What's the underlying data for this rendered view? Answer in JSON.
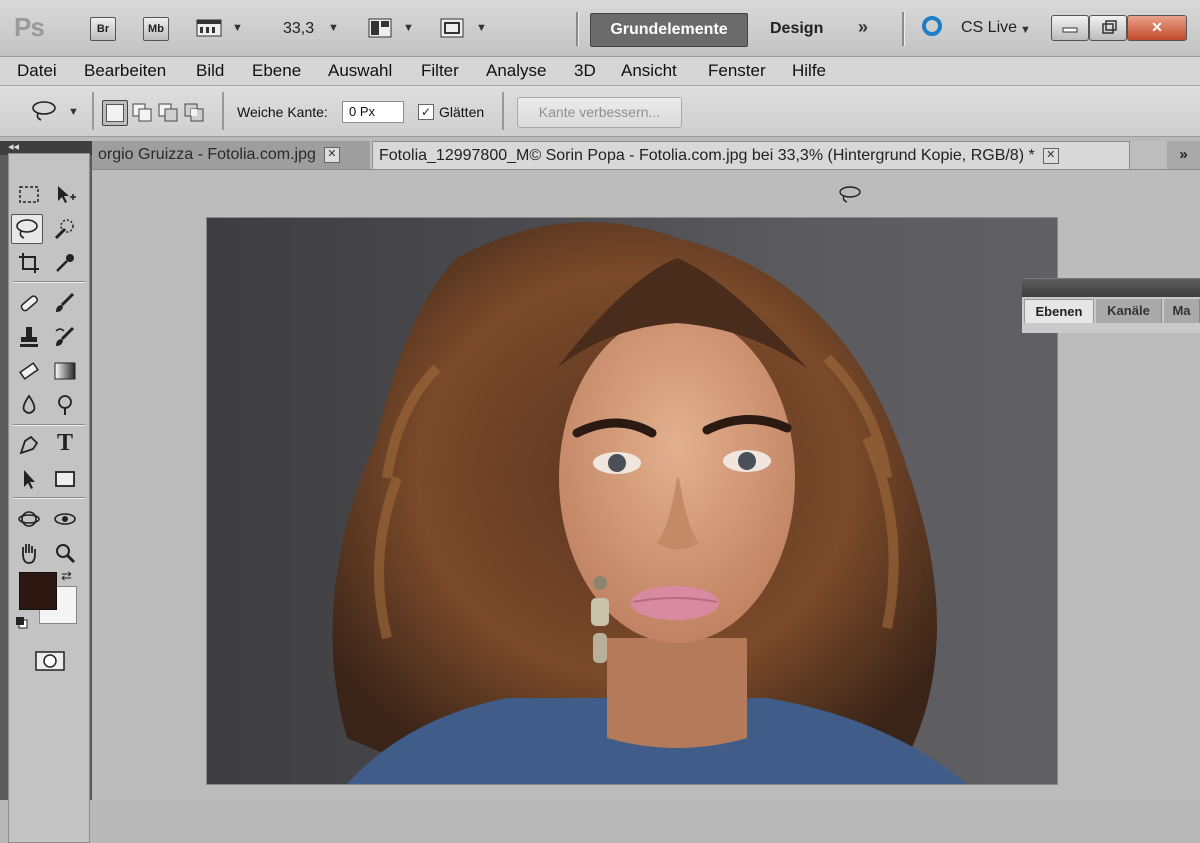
{
  "app": {
    "logo": "Ps",
    "bridge_button": "Br",
    "minibridge_button": "Mb",
    "zoom_value": "33,3",
    "workspace_active": "Grundelemente",
    "workspace_design": "Design",
    "workspace_more": "»",
    "cs_live": "CS Live",
    "window_close": "✕"
  },
  "menu": {
    "items": [
      "Datei",
      "Bearbeiten",
      "Bild",
      "Ebene",
      "Auswahl",
      "Filter",
      "Analyse",
      "3D",
      "Ansicht",
      "Fenster",
      "Hilfe"
    ]
  },
  "options": {
    "feather_label": "Weiche Kante:",
    "feather_value": "0 Px",
    "antialias_label": "Glätten",
    "antialias_checked": "✓",
    "refine_edge": "Kante verbessern..."
  },
  "tabs": {
    "inactive": "orgio Gruizza - Fotolia.com.jpg",
    "active": "Fotolia_12997800_M© Sorin Popa - Fotolia.com.jpg bei 33,3% (Hintergrund Kopie, RGB/8) *",
    "close": "✕",
    "overflow": "»"
  },
  "toolbox": {
    "collapse": "◂◂",
    "foreground_color": "#2b1610",
    "background_color": "#f4f4f4"
  },
  "layers_panel": {
    "tabs": [
      "Ebenen",
      "Kanäle",
      "Ma"
    ]
  },
  "colors": {
    "workspace_accent": "#6b6b6b",
    "cs_live_blue": "#1e7fc8"
  }
}
